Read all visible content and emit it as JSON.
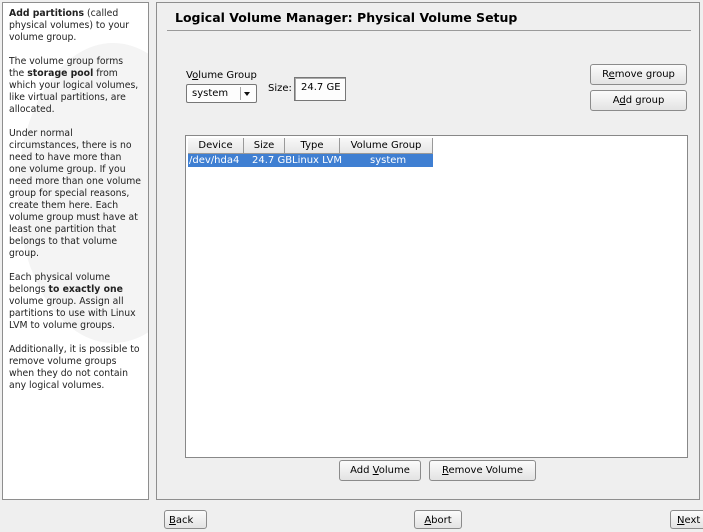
{
  "help": {
    "p1_bold": "Add partitions",
    "p1_rest": " (called physical volumes) to your volume group.",
    "p2_a": "The volume group forms the ",
    "p2_bold": "storage pool",
    "p2_b": " from which your logical volumes, like virtual partitions, are allocated.",
    "p3": "Under normal circumstances, there is no need to have more than one volume group. If you need more than one volume group for special reasons, create them here. Each volume group must have at least one partition that belongs to that volume group.",
    "p4_a": "Each physical volume belongs ",
    "p4_bold": "to exactly one",
    "p4_b": " volume group. Assign all partitions to use with Linux LVM to volume groups.",
    "p5": "Additionally, it is possible to remove volume groups when they do not contain any logical volumes."
  },
  "title": "Logical Volume Manager: Physical Volume Setup",
  "volume_group": {
    "label_pre": "V",
    "label_ul": "o",
    "label_post": "lume Group",
    "selected": "system",
    "size_label": "Size:",
    "size_value": "24.7 GE"
  },
  "buttons": {
    "remove_group": {
      "pre": "R",
      "ul": "e",
      "post": "move group"
    },
    "add_group": {
      "pre": "A",
      "ul": "d",
      "post": "d group"
    },
    "add_volume": {
      "pre": "Add ",
      "ul": "V",
      "post": "olume"
    },
    "remove_volume": {
      "pre": "",
      "ul": "R",
      "post": "emove Volume"
    }
  },
  "table": {
    "columns": [
      "Device",
      "Size",
      "Type",
      "Volume Group"
    ],
    "rows": [
      {
        "device": "/dev/hda4",
        "size": "24.7 GB",
        "type": "Linux LVM",
        "group": "system",
        "selected": true
      }
    ]
  },
  "nav": {
    "back": {
      "ul": "B",
      "post": "ack"
    },
    "abort": {
      "ul": "A",
      "post": "bort"
    },
    "next": {
      "ul": "N",
      "post": "ext"
    }
  },
  "colors": {
    "selection": "#3f7fd2",
    "background": "#efefef"
  }
}
